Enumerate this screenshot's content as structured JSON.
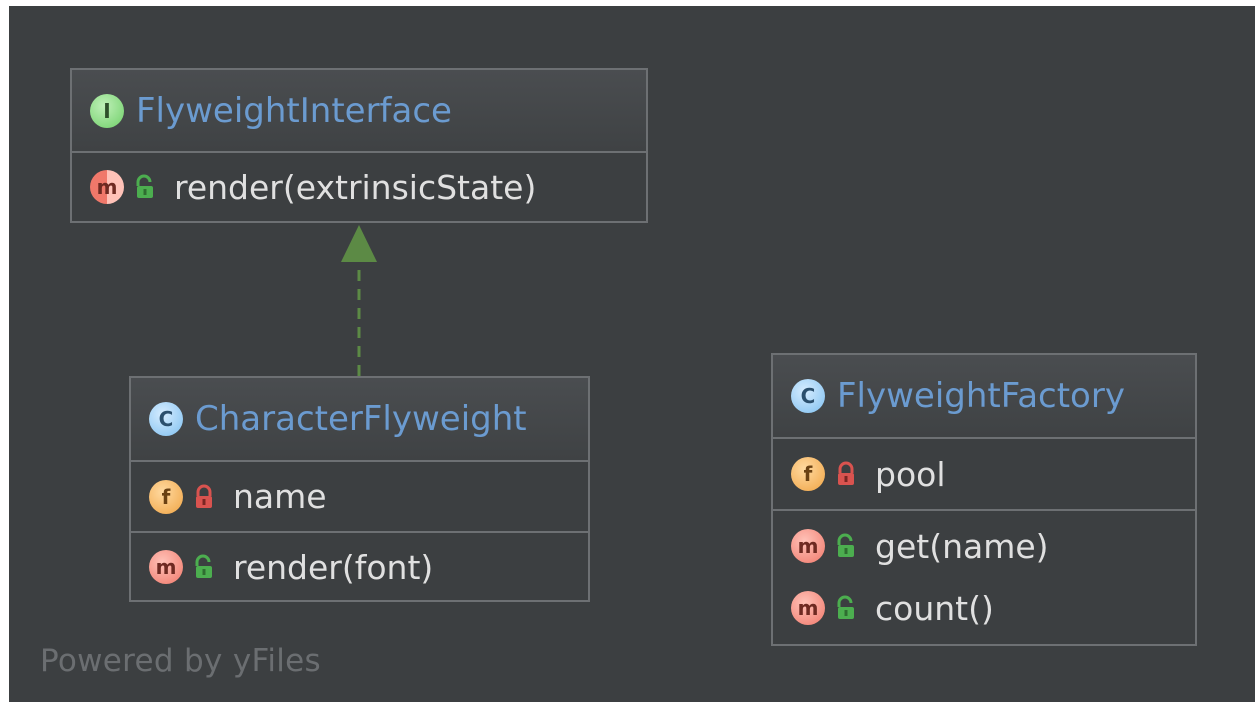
{
  "diagram": {
    "watermark": "Powered by yFiles",
    "classes": [
      {
        "id": "flyweight-interface",
        "kind": "interface",
        "badge": "I",
        "name": "FlyweightInterface",
        "fields": [],
        "methods": [
          {
            "badge": "m",
            "visibility": "public",
            "abstract": true,
            "signature": "render(extrinsicState)"
          }
        ]
      },
      {
        "id": "character-flyweight",
        "kind": "class",
        "badge": "C",
        "name": "CharacterFlyweight",
        "fields": [
          {
            "badge": "f",
            "visibility": "private",
            "signature": "name"
          }
        ],
        "methods": [
          {
            "badge": "m",
            "visibility": "public",
            "signature": "render(font)"
          }
        ]
      },
      {
        "id": "flyweight-factory",
        "kind": "class",
        "badge": "C",
        "name": "FlyweightFactory",
        "fields": [
          {
            "badge": "f",
            "visibility": "private",
            "signature": "pool"
          }
        ],
        "methods": [
          {
            "badge": "m",
            "visibility": "public",
            "signature": "get(name)"
          },
          {
            "badge": "m",
            "visibility": "public",
            "signature": "count()"
          }
        ]
      }
    ],
    "relations": [
      {
        "from": "character-flyweight",
        "to": "flyweight-interface",
        "type": "realization",
        "style": "dashed",
        "arrow": "hollow-triangle"
      }
    ],
    "colors": {
      "background": "#3c3f41",
      "border": "#6d7073",
      "class_name": "#6b9bd0",
      "member_text": "#e0e0e0",
      "edge": "#5c8a45",
      "public_lock": "#4cae4f",
      "private_lock": "#d9534f"
    },
    "icons": {
      "public": "unlocked-padlock-icon",
      "private": "locked-padlock-icon"
    }
  }
}
